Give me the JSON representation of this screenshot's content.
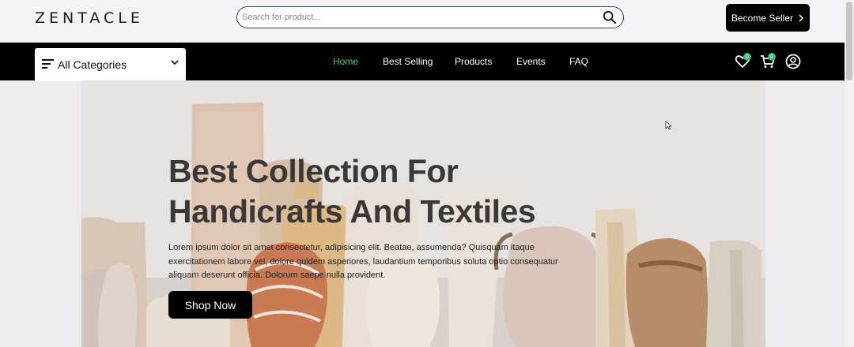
{
  "header": {
    "logo": "ZENTACLE",
    "search": {
      "placeholder": "Search for product..."
    },
    "seller_button": {
      "label": "Become Seller",
      "icon": "chevron-right-icon"
    }
  },
  "nav": {
    "categories": {
      "label": "All Categories",
      "icon": "menu-icon"
    },
    "links": [
      {
        "label": "Home",
        "active": true
      },
      {
        "label": "Best Selling",
        "active": false
      },
      {
        "label": "Products",
        "active": false
      },
      {
        "label": "Events",
        "active": false
      },
      {
        "label": "FAQ",
        "active": false
      }
    ],
    "wishlist_count": "0",
    "cart_count": "0",
    "active_color": "#4ccc6c",
    "badge_color": "#3bb77e"
  },
  "hero": {
    "title_line1": "Best Collection For",
    "title_line2": "Handicrafts And Textiles",
    "text": "Lorem ipsum dolor sit amet consectetur, adipisicing elit. Beatae, assumenda? Quisquam itaque exercitationem labore vel, dolore quidem asperiores, laudantium temporibus soluta optio consequatur aliquam deserunt officia. Dolorum saepe nulla provident.",
    "button_label": "Shop Now"
  }
}
